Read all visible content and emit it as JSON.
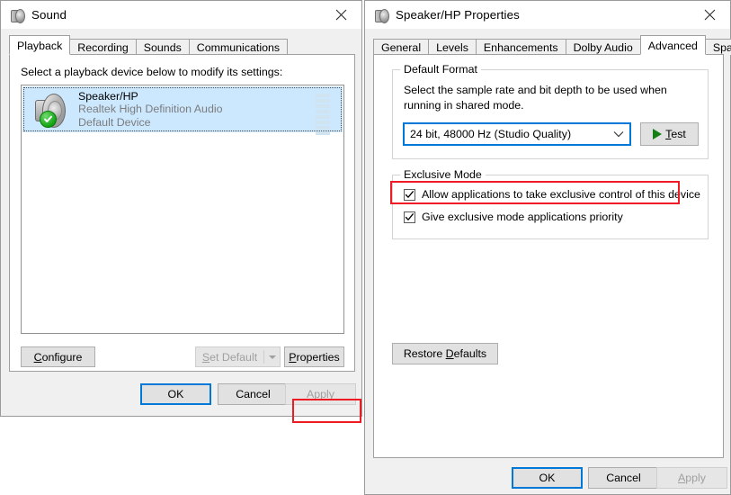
{
  "sound_dialog": {
    "title": "Sound",
    "title_icon": "speaker-icon",
    "close_icon": "close-icon",
    "tabs": [
      {
        "label": "Playback",
        "active": true
      },
      {
        "label": "Recording",
        "active": false
      },
      {
        "label": "Sounds",
        "active": false
      },
      {
        "label": "Communications",
        "active": false
      }
    ],
    "instruction": "Select a playback device below to modify its settings:",
    "device": {
      "name": "Speaker/HP",
      "driver": "Realtek High Definition Audio",
      "status": "Default Device",
      "selected": true,
      "badge_icon": "green-check-icon",
      "meter_segments": 8
    },
    "buttons": {
      "configure": "Configure",
      "configure_accel": "C",
      "set_default": "Set Default",
      "set_default_accel": "S",
      "set_default_disabled": true,
      "properties": "Properties",
      "properties_accel": "P",
      "properties_highlighted": true,
      "ok": "OK",
      "cancel": "Cancel",
      "apply": "Apply",
      "apply_disabled": true
    }
  },
  "properties_dialog": {
    "title": "Speaker/HP Properties",
    "title_icon": "speaker-icon",
    "close_icon": "close-icon",
    "tabs": [
      {
        "label": "General",
        "active": false
      },
      {
        "label": "Levels",
        "active": false
      },
      {
        "label": "Enhancements",
        "active": false
      },
      {
        "label": "Dolby Audio",
        "active": false
      },
      {
        "label": "Advanced",
        "active": true
      },
      {
        "label": "Spatial sound",
        "active": false
      }
    ],
    "default_format": {
      "group_title": "Default Format",
      "description": "Select the sample rate and bit depth to be used when running in shared mode.",
      "selected_value": "24 bit, 48000 Hz (Studio Quality)",
      "dropdown_icon": "chevron-down-icon",
      "test_button": "Test",
      "test_accel": "T",
      "test_icon": "play-icon"
    },
    "exclusive_mode": {
      "group_title": "Exclusive Mode",
      "checkboxes": [
        {
          "label": "Allow applications to take exclusive control of this device",
          "checked": true,
          "highlighted": true
        },
        {
          "label": "Give exclusive mode applications priority",
          "checked": true,
          "highlighted": false
        }
      ]
    },
    "buttons": {
      "restore_defaults": "Restore Defaults",
      "restore_defaults_accel": "D",
      "ok": "OK",
      "cancel": "Cancel",
      "apply": "Apply",
      "apply_disabled": true
    }
  },
  "colors": {
    "accent": "#0078d7",
    "highlight": "#ee1b24",
    "selection": "#cce8ff",
    "dialog_bg": "#f0f0f0"
  }
}
